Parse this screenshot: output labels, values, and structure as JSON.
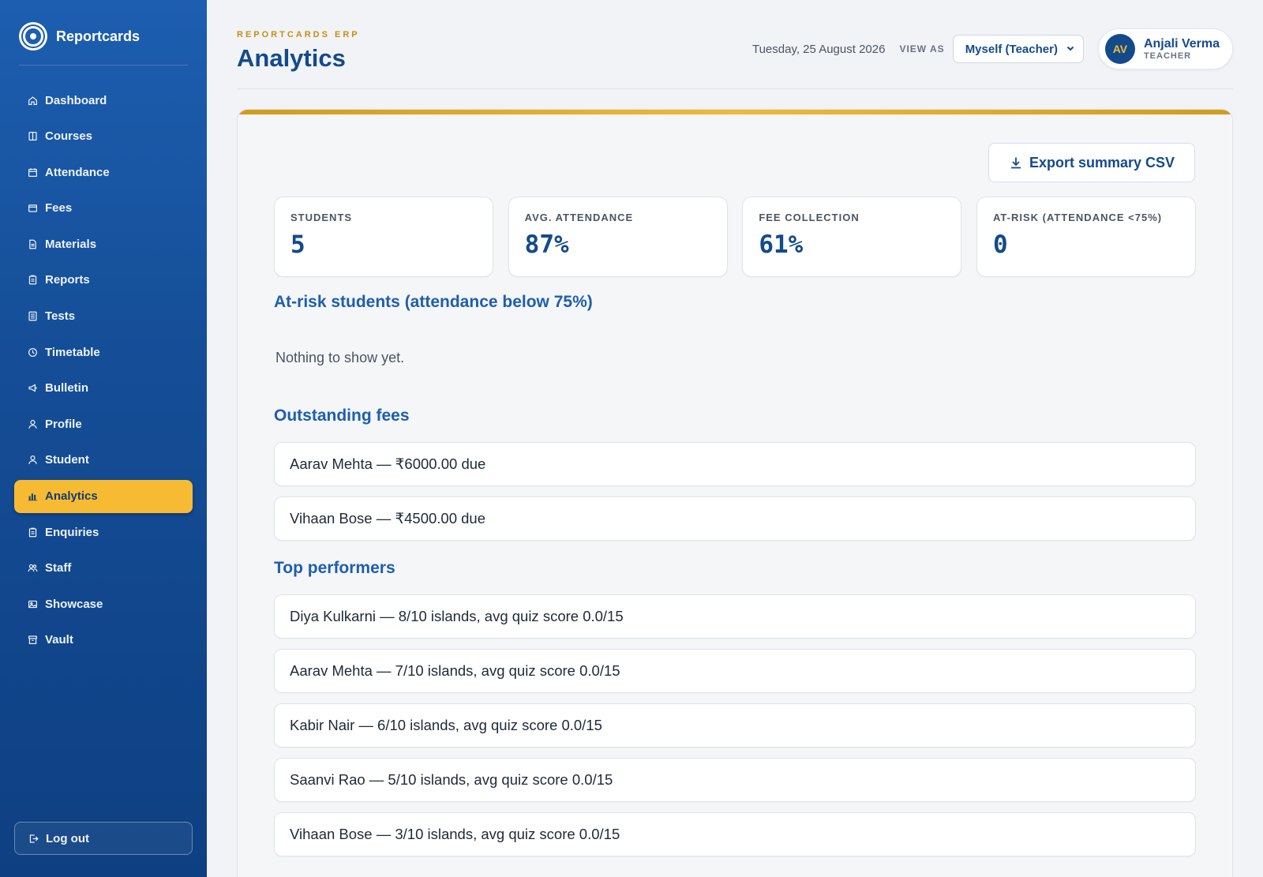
{
  "app": {
    "name": "Reportcards"
  },
  "sidebar": {
    "items": [
      {
        "label": "Dashboard",
        "icon": "home-icon"
      },
      {
        "label": "Courses",
        "icon": "book-icon"
      },
      {
        "label": "Attendance",
        "icon": "calendar-icon"
      },
      {
        "label": "Fees",
        "icon": "wallet-icon"
      },
      {
        "label": "Materials",
        "icon": "file-icon"
      },
      {
        "label": "Reports",
        "icon": "clipboard-icon"
      },
      {
        "label": "Tests",
        "icon": "checklist-icon"
      },
      {
        "label": "Timetable",
        "icon": "clock-icon"
      },
      {
        "label": "Bulletin",
        "icon": "megaphone-icon"
      },
      {
        "label": "Profile",
        "icon": "user-icon"
      },
      {
        "label": "Student",
        "icon": "user-icon"
      },
      {
        "label": "Analytics",
        "icon": "bar-chart-icon",
        "active": true
      },
      {
        "label": "Enquiries",
        "icon": "clipboard-icon"
      },
      {
        "label": "Staff",
        "icon": "users-icon"
      },
      {
        "label": "Showcase",
        "icon": "image-icon"
      },
      {
        "label": "Vault",
        "icon": "archive-icon"
      }
    ],
    "logout_label": "Log out"
  },
  "header": {
    "eyebrow": "REPORTCARDS ERP",
    "title": "Analytics",
    "date": "Tuesday, 25 August 2026",
    "view_as_label": "VIEW AS",
    "view_as_value": "Myself (Teacher)",
    "user": {
      "initials": "AV",
      "name": "Anjali Verma",
      "role": "TEACHER"
    }
  },
  "actions": {
    "export_label": "Export summary CSV"
  },
  "stats": [
    {
      "label": "STUDENTS",
      "value": "5"
    },
    {
      "label": "AVG. ATTENDANCE",
      "value": "87%"
    },
    {
      "label": "FEE COLLECTION",
      "value": "61%"
    },
    {
      "label": "AT-RISK (ATTENDANCE <75%)",
      "value": "0"
    }
  ],
  "at_risk": {
    "title": "At-risk students (attendance below 75%)",
    "empty": "Nothing to show yet."
  },
  "outstanding_fees": {
    "title": "Outstanding fees",
    "items": [
      "Aarav Mehta — ₹6000.00 due",
      "Vihaan Bose — ₹4500.00 due"
    ]
  },
  "top_performers": {
    "title": "Top performers",
    "items": [
      "Diya Kulkarni — 8/10 islands, avg quiz score 0.0/15",
      "Aarav Mehta — 7/10 islands, avg quiz score 0.0/15",
      "Kabir Nair — 6/10 islands, avg quiz score 0.0/15",
      "Saanvi Rao — 5/10 islands, avg quiz score 0.0/15",
      "Vihaan Bose — 3/10 islands, avg quiz score 0.0/15"
    ]
  },
  "colors": {
    "primary": "#134a8c",
    "accent": "#f7bb33",
    "sidebar": "#1d5eb0"
  }
}
